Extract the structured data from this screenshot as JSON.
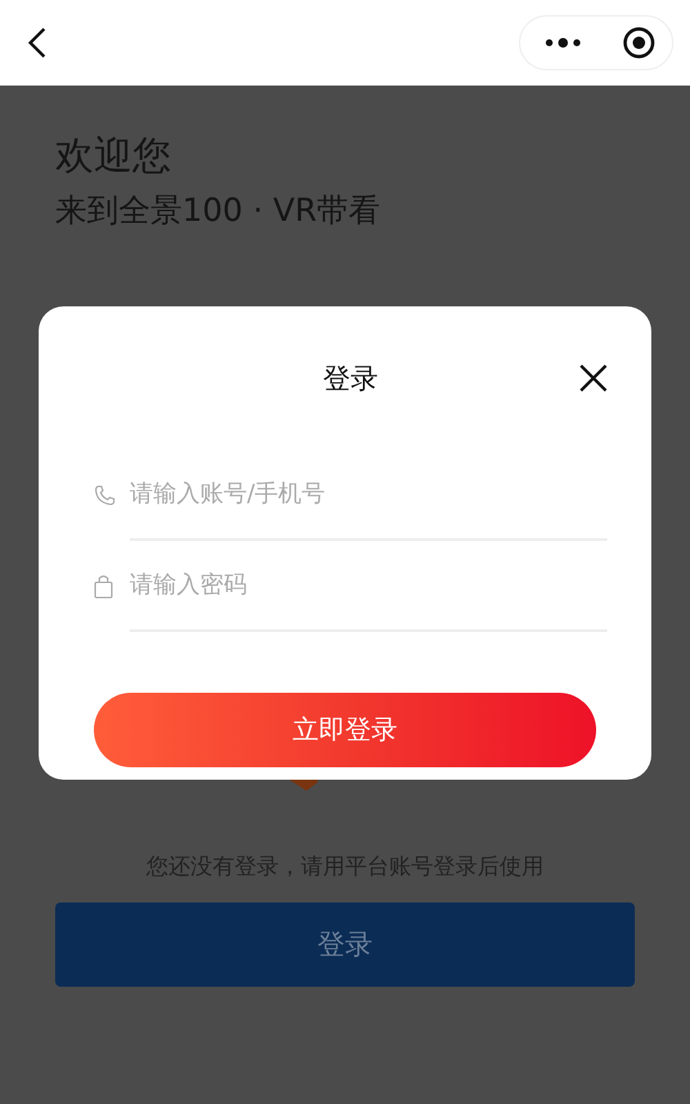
{
  "page": {
    "greeting": "欢迎您",
    "subtitle": "来到全景100 · VR带看",
    "hint": "您还没有登录，请用平台账号登录后使用",
    "login_button": "登录"
  },
  "dialog": {
    "title": "登录",
    "fields": [
      {
        "kind": "phone",
        "placeholder": "请输入账号/手机号"
      },
      {
        "kind": "password",
        "placeholder": "请输入密码"
      }
    ],
    "submit": "立即登录"
  }
}
